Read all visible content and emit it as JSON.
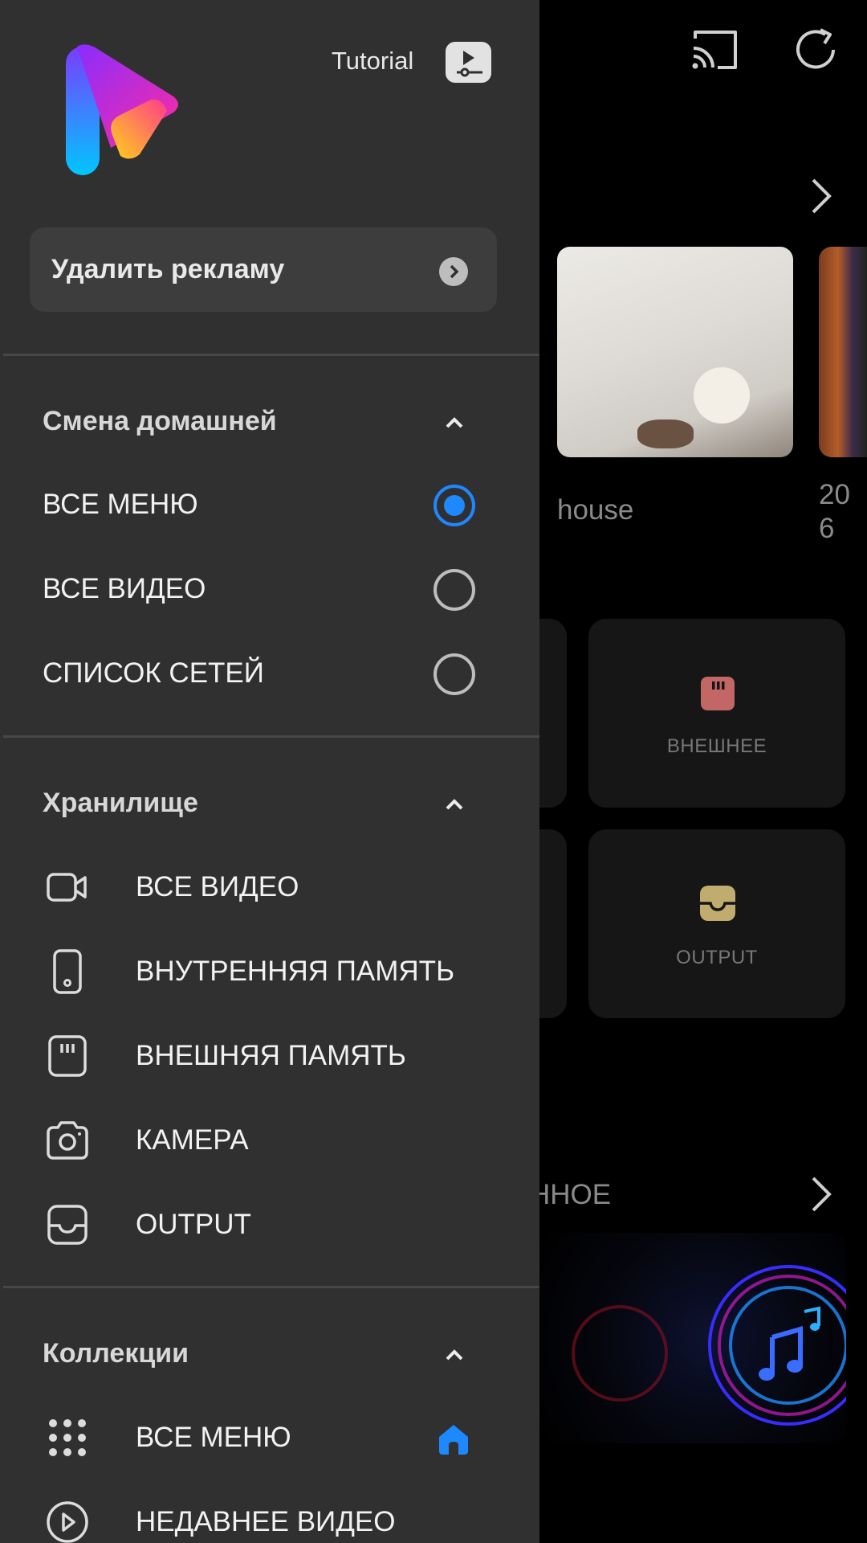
{
  "background": {
    "thumbnail_title": "house",
    "thumbnail_title_2": "20\n6",
    "tiles": [
      {
        "label": "ВНЕШНЕЕ",
        "icon": "sd-card-icon",
        "color": "#c26666"
      },
      {
        "label": "OUTPUT",
        "icon": "inbox-icon",
        "color": "#bfac6e"
      }
    ],
    "section_fragment": "ННОЕ"
  },
  "drawer": {
    "tutorial_label": "Tutorial",
    "remove_ads_label": "Удалить рекламу",
    "home_section": {
      "title": "Смена домашней",
      "options": [
        {
          "label": "ВСЕ МЕНЮ",
          "selected": true
        },
        {
          "label": "ВСЕ ВИДЕО",
          "selected": false
        },
        {
          "label": "СПИСОК СЕТЕЙ",
          "selected": false
        }
      ]
    },
    "storage_section": {
      "title": "Хранилище",
      "items": [
        {
          "label": "ВСЕ ВИДЕО",
          "icon": "video-camera-icon"
        },
        {
          "label": "ВНУТРЕННЯЯ ПАМЯТЬ",
          "icon": "phone-icon"
        },
        {
          "label": "ВНЕШНЯЯ ПАМЯТЬ",
          "icon": "sd-card-icon"
        },
        {
          "label": "КАМЕРА",
          "icon": "camera-icon"
        },
        {
          "label": "OUTPUT",
          "icon": "inbox-icon"
        }
      ]
    },
    "collections_section": {
      "title": "Коллекции",
      "items": [
        {
          "label": "ВСЕ МЕНЮ",
          "icon": "grid-icon",
          "is_home": true
        },
        {
          "label": "НЕДАВНЕЕ ВИДЕО",
          "icon": "play-circle-icon",
          "is_home": false
        }
      ]
    }
  },
  "colors": {
    "accent": "#1e88ff",
    "drawer_bg": "#303030"
  }
}
